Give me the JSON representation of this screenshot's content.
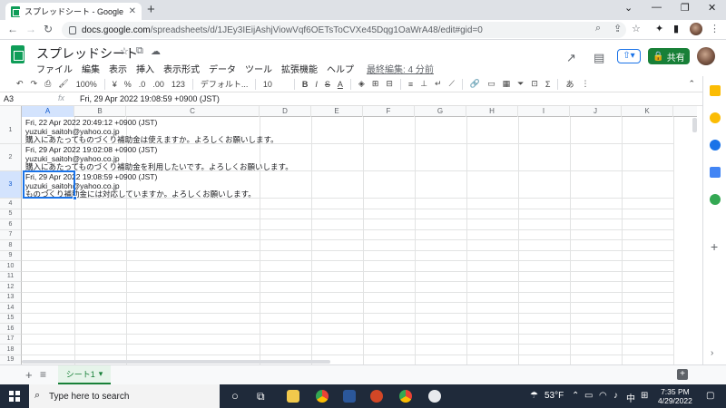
{
  "browser": {
    "tab_title": "スプレッドシート - Google スプレッドシ",
    "url_host": "docs.google.com",
    "url_path": "/spreadsheets/d/1JEy3IEijAshjViowVqf6OETsToCVXe45Dqg1OaWrA48/edit#gid=0"
  },
  "doc": {
    "title": "スプレッドシート",
    "menus": [
      "ファイル",
      "編集",
      "表示",
      "挿入",
      "表示形式",
      "データ",
      "ツール",
      "拡張機能",
      "ヘルプ"
    ],
    "last_edit": "最終編集: 4 分前",
    "share_label": "共有"
  },
  "toolbar": {
    "zoom": "100%",
    "currency": "¥",
    "percent": "%",
    "decimal_dec": ".0",
    "decimal_inc": ".00",
    "more_formats": "123",
    "font": "デフォルト...",
    "font_size": "10",
    "bold": "B",
    "italic": "I",
    "strike": "S",
    "text_color": "A"
  },
  "formula_bar": {
    "cell_ref": "A3",
    "fx": "fx",
    "value": "Fri, 29 Apr 2022 19:08:59 +0900 (JST)"
  },
  "grid": {
    "columns": [
      "A",
      "B",
      "C",
      "D",
      "E",
      "F",
      "G",
      "H",
      "I",
      "J",
      "K"
    ],
    "row_numbers": [
      "1",
      "2",
      "3",
      "4",
      "5",
      "6",
      "7",
      "8",
      "9",
      "10",
      "11",
      "12",
      "13",
      "14",
      "15",
      "16",
      "17",
      "18",
      "19"
    ],
    "selected_cell": "A3",
    "rows": [
      {
        "line1": "Fri, 22 Apr 2022 20:49:12 +0900 (JST)",
        "line2": "yuzuki_saitoh@yahoo.co.jp",
        "line3": "購入にあたってものづくり補助金は使えますか。よろしくお願いします。"
      },
      {
        "line1": "Fri, 29 Apr 2022 19:02:08 +0900 (JST)",
        "line2": "yuzuki_saitoh@yahoo.co.jp",
        "line3": "購入にあたってものづくり補助金を利用したいです。よろしくお願いします。"
      },
      {
        "line1": "Fri, 29 Apr 2022 19:08:59 +0900 (JST)",
        "line2": "yuzuki_saitoh@yahoo.co.jp",
        "line3": "ものづくり補助金には対応していますか。よろしくお願いします。"
      }
    ]
  },
  "sheets": {
    "add_label": "+",
    "list_label": "≡",
    "active_sheet": "シート1"
  },
  "taskbar": {
    "search_placeholder": "Type here to search",
    "weather": "53°F",
    "ime": "中",
    "time": "7:35 PM",
    "date": "4/29/2022"
  }
}
